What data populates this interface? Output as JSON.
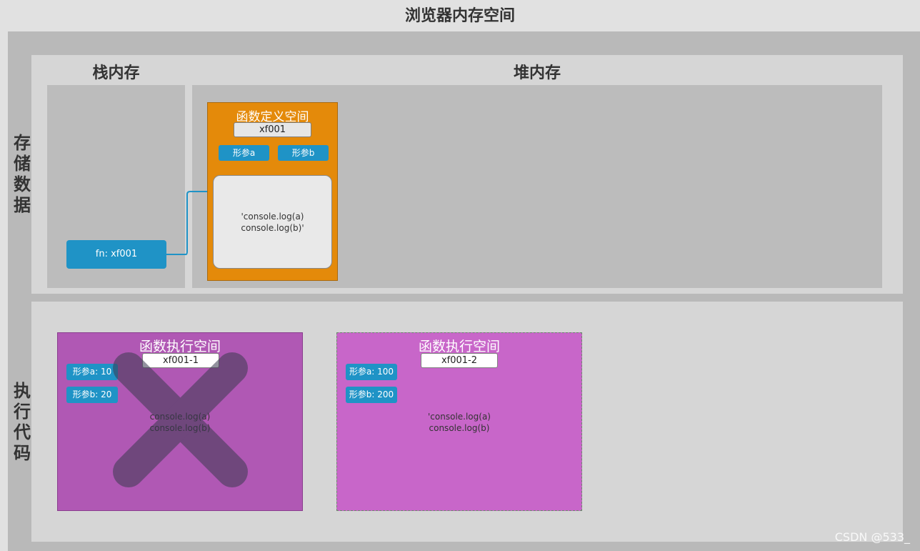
{
  "title": "浏览器内存空间",
  "labels": {
    "stack": "栈内存",
    "heap": "堆内存",
    "store_data": [
      "存",
      "储",
      "数",
      "据"
    ],
    "execute_code": [
      "执",
      "行",
      "代",
      "码"
    ]
  },
  "stack_var": "fn: xf001",
  "func_def": {
    "title": "函数定义空间",
    "address": "xf001",
    "params": [
      "形参a",
      "形参b"
    ],
    "code_line1": "'console.log(a)",
    "code_line2": "console.log(b)'"
  },
  "exec1": {
    "title": "函数执行空间",
    "address": "xf001-1",
    "params": [
      "形参a: 10",
      "形参b: 20"
    ],
    "code_line1": "console.log(a)",
    "code_line2": "console.log(b)"
  },
  "exec2": {
    "title": "函数执行空间",
    "address": "xf001-2",
    "params": [
      "形参a: 100",
      "形参b: 200"
    ],
    "code_line1": "'console.log(a)",
    "code_line2": "console.log(b)"
  },
  "watermark": "CSDN @533_",
  "colors": {
    "func_def_bg": "#e48a0a",
    "exec1_bg": "#b058b4",
    "exec2_bg": "#c866c9",
    "param_pill": "#1f93c6",
    "connector": "#1f93c6"
  }
}
